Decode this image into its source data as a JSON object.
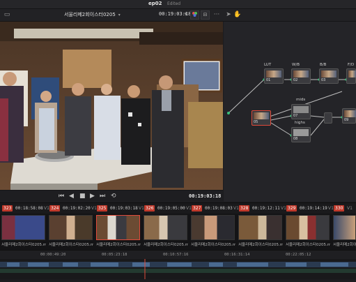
{
  "header": {
    "project_title": "ep02",
    "edited": "Edited"
  },
  "viewer": {
    "clip_name": "서울리메2회이스터0205",
    "timecode": "00:19:03:18",
    "playhead_timecode": "00:19:03:18"
  },
  "node_graph": {
    "nodes": [
      {
        "label": "LUT",
        "num": "01"
      },
      {
        "label": "W/B",
        "num": "02"
      },
      {
        "label": "B/B",
        "num": "03"
      },
      {
        "label": "F/D",
        "num": "04"
      },
      {
        "label": "",
        "num": "05"
      },
      {
        "label": "mids",
        "num": "07"
      },
      {
        "label": "highs",
        "num": "08"
      },
      {
        "label": "",
        "num": "09"
      }
    ]
  },
  "clips": [
    {
      "num": "323",
      "tc": "00:18:58:08",
      "track": "V1",
      "name": "서울리메2회이스터0205.m..."
    },
    {
      "num": "324",
      "tc": "00:19:02:20",
      "track": "V1",
      "name": "서울리메2회이스터0205.m..."
    },
    {
      "num": "325",
      "tc": "00:19:03:18",
      "track": "V1",
      "name": "서울리메2회이스터0205.m..."
    },
    {
      "num": "326",
      "tc": "00:19:05:00",
      "track": "V1",
      "name": "서울리메2회이스터0205.m..."
    },
    {
      "num": "327",
      "tc": "00:19:08:03",
      "track": "V1",
      "name": "서울리메2회이스터0205.m..."
    },
    {
      "num": "328",
      "tc": "00:19:12:11",
      "track": "V1",
      "name": "서울리메2회이스터0205.m..."
    },
    {
      "num": "329",
      "tc": "00:19:14:19",
      "track": "V1",
      "name": "서울리메2회이스터0205.m..."
    },
    {
      "num": "330",
      "tc": "",
      "track": "V1",
      "name": "서울리메2회이스터0205.m"
    }
  ],
  "ruler": [
    "00:00:49:20",
    "00:05:23:18",
    "00:10:57:16",
    "00:16:31:14",
    "00:22:05:12"
  ],
  "colors": {
    "accent": "#e04a3a",
    "node_bg": "#3a3a3e",
    "panel_bg": "#242428",
    "clip_num_bg": "#c0392b"
  },
  "icons": [
    "pointer-icon",
    "hand-icon",
    "more-icon",
    "color-icon",
    "play-icon",
    "stop-icon",
    "loop-icon",
    "prev-icon",
    "next-icon"
  ]
}
